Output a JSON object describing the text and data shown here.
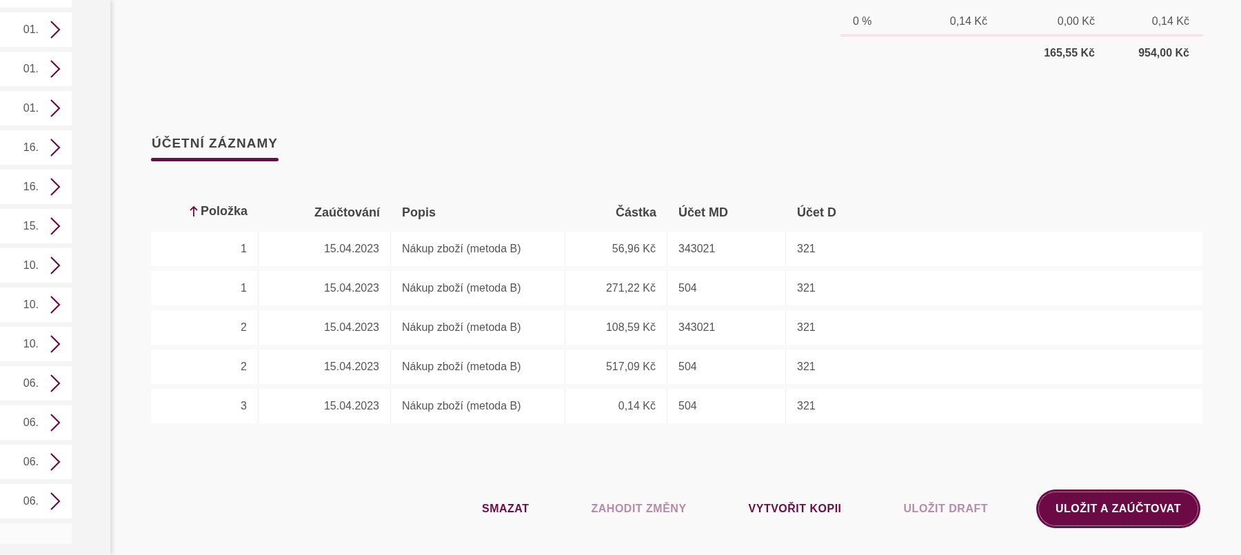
{
  "sidebar": {
    "items": [
      {
        "label": "01."
      },
      {
        "label": "01."
      },
      {
        "label": "01."
      },
      {
        "label": "16."
      },
      {
        "label": "16."
      },
      {
        "label": "15."
      },
      {
        "label": "10."
      },
      {
        "label": "10."
      },
      {
        "label": "10."
      },
      {
        "label": "06."
      },
      {
        "label": "06."
      },
      {
        "label": "06."
      },
      {
        "label": "06."
      }
    ]
  },
  "summary": {
    "rows": [
      {
        "cells": [
          "0 %",
          "0,14 Kč",
          "0,00 Kč",
          "0,14 Kč"
        ]
      }
    ],
    "totals": [
      "165,55 Kč",
      "954,00 Kč"
    ]
  },
  "section": {
    "title": "ÚČETNÍ ZÁZNAMY"
  },
  "table": {
    "columns": [
      {
        "label": "Položka",
        "sorted": true
      },
      {
        "label": "Zaúčtování",
        "sorted": false
      },
      {
        "label": "Popis",
        "sorted": false
      },
      {
        "label": "Částka",
        "sorted": false
      },
      {
        "label": "Účet MD",
        "sorted": false
      },
      {
        "label": "Účet D",
        "sorted": false
      }
    ],
    "rows": [
      [
        "1",
        "15.04.2023",
        "Nákup zboží (metoda B)",
        "56,96 Kč",
        "343021",
        "321"
      ],
      [
        "1",
        "15.04.2023",
        "Nákup zboží (metoda B)",
        "271,22 Kč",
        "504",
        "321"
      ],
      [
        "2",
        "15.04.2023",
        "Nákup zboží (metoda B)",
        "108,59 Kč",
        "343021",
        "321"
      ],
      [
        "2",
        "15.04.2023",
        "Nákup zboží (metoda B)",
        "517,09 Kč",
        "504",
        "321"
      ],
      [
        "3",
        "15.04.2023",
        "Nákup zboží (metoda B)",
        "0,14 Kč",
        "504",
        "321"
      ]
    ]
  },
  "buttons": [
    {
      "label": "SMAZAT",
      "kind": "text",
      "disabled": false
    },
    {
      "label": "ZAHODIT ZMĚNY",
      "kind": "text",
      "disabled": true
    },
    {
      "label": "VYTVOŘIT KOPII",
      "kind": "text",
      "disabled": false
    },
    {
      "label": "ULOŽIT DRAFT",
      "kind": "text",
      "disabled": true
    },
    {
      "label": "ULOŽIT A ZAÚČTOVAT",
      "kind": "primary",
      "disabled": false
    }
  ]
}
